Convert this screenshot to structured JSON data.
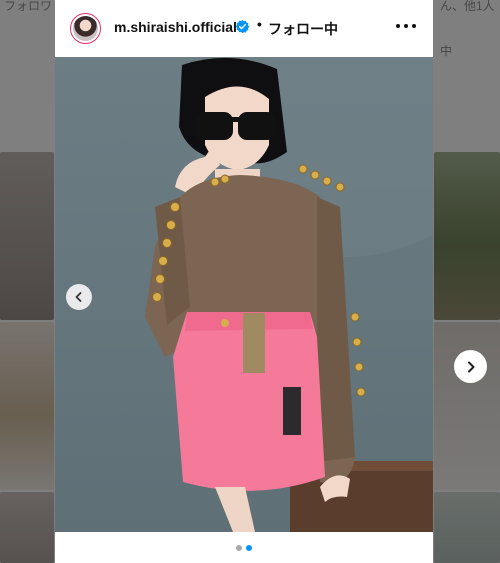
{
  "background": {
    "top_text_left": "フォロワ",
    "top_text_right": "ん、他1人",
    "right_text": "中"
  },
  "post": {
    "username": "m.shiraishi.official",
    "separator": "•",
    "follow_label": "フォロー中",
    "verified_icon": "verified-badge-icon",
    "more_icon": "more-options-icon",
    "prev_icon": "chevron-left-icon",
    "next_icon": "chevron-right-icon"
  },
  "carousel": {
    "total_slides": 2,
    "active_slide": 2
  },
  "colors": {
    "accent": "#0095f6",
    "verified": "#0095f6",
    "story_ring": "#e1306c"
  }
}
